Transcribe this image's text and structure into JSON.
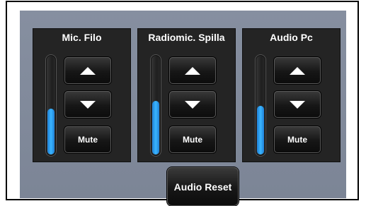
{
  "colors": {
    "panel_background": "#7f8899",
    "channel_background": "#242424",
    "level_fill": "#2e9ff0"
  },
  "channels": [
    {
      "title": "Mic. Filo",
      "level": 0.47,
      "up_icon": "triangle-up",
      "down_icon": "triangle-down",
      "mute_label": "Mute"
    },
    {
      "title": "Radiomic. Spilla",
      "level": 0.55,
      "up_icon": "triangle-up",
      "down_icon": "triangle-down",
      "mute_label": "Mute"
    },
    {
      "title": "Audio Pc",
      "level": 0.5,
      "up_icon": "triangle-up",
      "down_icon": "triangle-down",
      "mute_label": "Mute"
    }
  ],
  "reset_label": "Audio Reset"
}
